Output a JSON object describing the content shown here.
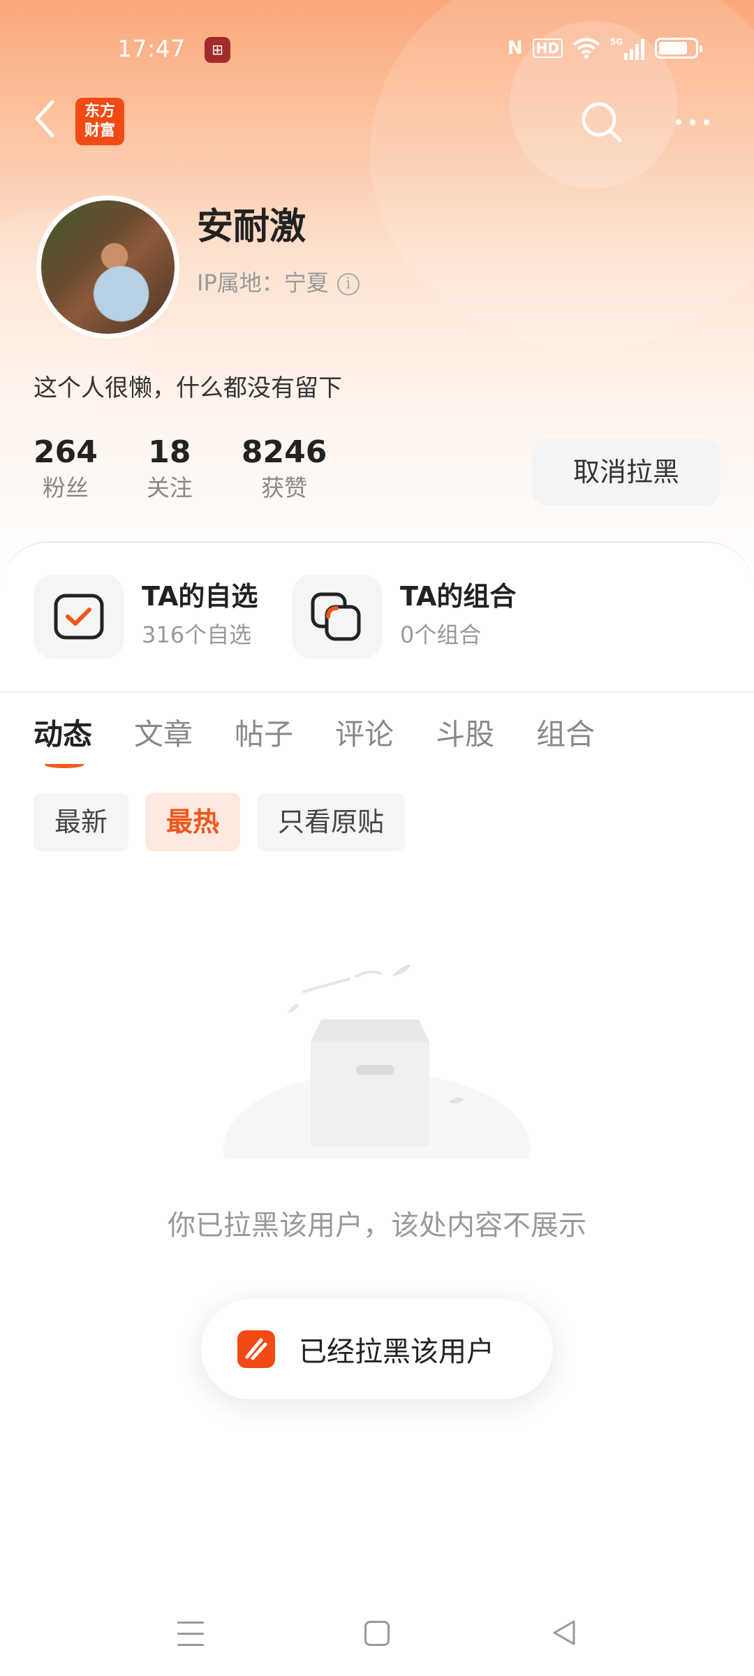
{
  "status_bar": {
    "time": "17:47",
    "app_notification_icon": "bank-app-icon",
    "indicators": [
      "nfc-icon",
      "hd-icon",
      "wifi-icon",
      "5g-signal-icon",
      "battery-icon"
    ]
  },
  "header": {
    "back_icon": "chevron-left-icon",
    "brand_logo_line1": "东方",
    "brand_logo_line2": "财富",
    "search_icon": "search-icon",
    "more_icon": "more-dots-icon"
  },
  "profile": {
    "name": "安耐激",
    "ip_location": "IP属地：宁夏",
    "bio": "这个人很懒，什么都没有留下",
    "stats": [
      {
        "value": "264",
        "label": "粉丝"
      },
      {
        "value": "18",
        "label": "关注"
      },
      {
        "value": "8246",
        "label": "获赞"
      }
    ],
    "unblock_button": "取消拉黑"
  },
  "features": [
    {
      "title": "TA的自选",
      "subtitle": "316个自选",
      "icon": "watchlist-check-icon"
    },
    {
      "title": "TA的组合",
      "subtitle": "0个组合",
      "icon": "portfolio-icon"
    }
  ],
  "tabs": [
    "动态",
    "文章",
    "帖子",
    "评论",
    "斗股",
    "组合"
  ],
  "active_tab": "动态",
  "filters": [
    "最新",
    "最热",
    "只看原贴"
  ],
  "active_filter": "最热",
  "empty_state": {
    "illustration": "empty-box-icon",
    "message": "你已拉黑该用户，该处内容不展示"
  },
  "toast": {
    "message": "已经拉黑该用户"
  },
  "colors": {
    "accent": "#f0561c",
    "header_gradient_top": "#fba77a"
  }
}
